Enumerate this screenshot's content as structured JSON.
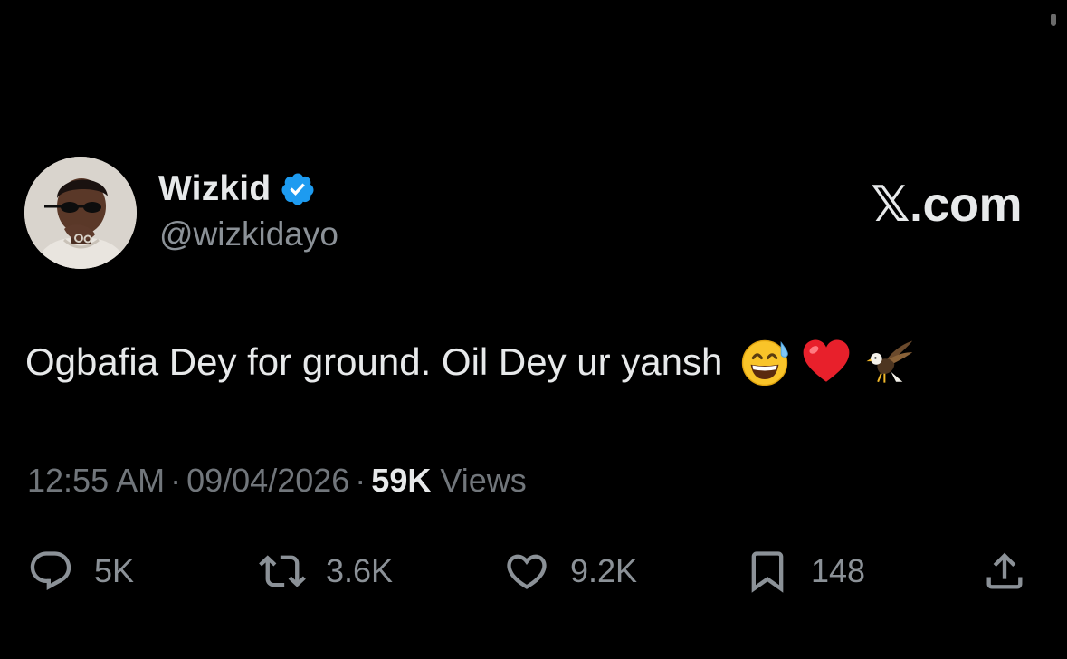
{
  "brand": "𝕏.com",
  "author": {
    "display_name": "Wizkid",
    "handle": "@wizkidayo",
    "verified": true,
    "verified_color": "#1d9bf0"
  },
  "tweet": {
    "text": "Ogbafia Dey for ground. Oil Dey ur yansh",
    "emojis": [
      "grinning-face-with-sweat",
      "red-heart",
      "eagle"
    ]
  },
  "meta": {
    "time": "12:55 AM",
    "separator": "·",
    "date": "09/04/2026",
    "views_count": "59K",
    "views_label": "Views"
  },
  "actions": {
    "reply": {
      "icon": "reply-icon",
      "count": "5K"
    },
    "retweet": {
      "icon": "retweet-icon",
      "count": "3.6K"
    },
    "like": {
      "icon": "heart-icon",
      "count": "9.2K"
    },
    "bookmark": {
      "icon": "bookmark-icon",
      "count": "148"
    },
    "share": {
      "icon": "share-icon"
    }
  },
  "colors": {
    "background": "#000000",
    "primary_text": "#e7e9ea",
    "secondary_text": "#71767b",
    "icon": "#8b9197"
  }
}
